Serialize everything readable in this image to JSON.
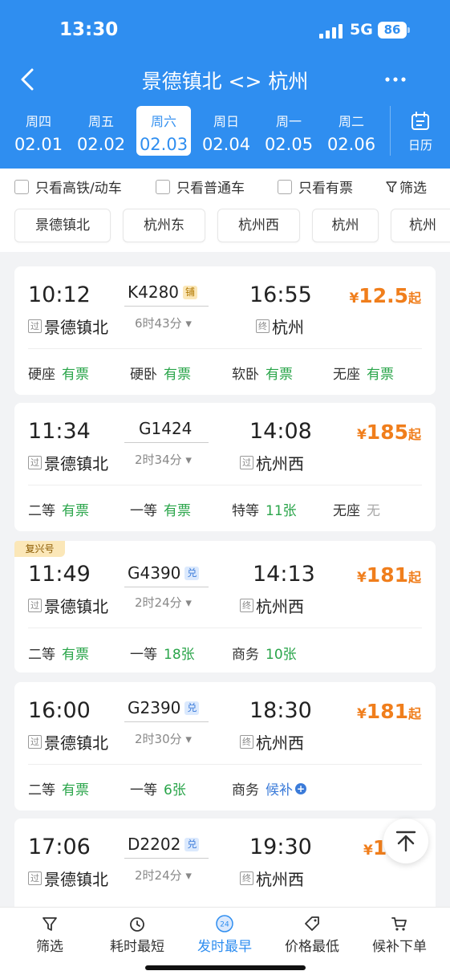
{
  "status": {
    "time": "13:30",
    "network": "5G",
    "battery": "86"
  },
  "nav": {
    "title": "景德镇北 <> 杭州"
  },
  "dates": [
    {
      "weekday": "周四",
      "date": "02.01"
    },
    {
      "weekday": "周五",
      "date": "02.02"
    },
    {
      "weekday": "周六",
      "date": "02.03",
      "active": true
    },
    {
      "weekday": "周日",
      "date": "02.04"
    },
    {
      "weekday": "周一",
      "date": "02.05"
    },
    {
      "weekday": "周二",
      "date": "02.06"
    }
  ],
  "calendar_label": "日历",
  "filters": {
    "high_speed": "只看高铁/动车",
    "normal": "只看普通车",
    "available": "只看有票",
    "filter": "筛选"
  },
  "stations": [
    "景德镇北",
    "杭州东",
    "杭州西",
    "杭州",
    "杭州"
  ],
  "trains": [
    {
      "dep": "10:12",
      "arr": "16:55",
      "train": "K4280",
      "badge": "铺",
      "duration": "6时43分",
      "from_tag": "过",
      "from": "景德镇北",
      "to_tag": "终",
      "to": "杭州",
      "price": "12.5",
      "currency": "¥",
      "price_suffix": "起",
      "seats": [
        {
          "name": "硬座",
          "value": "有票"
        },
        {
          "name": "硬卧",
          "value": "有票"
        },
        {
          "name": "软卧",
          "value": "有票"
        },
        {
          "name": "无座",
          "value": "有票"
        }
      ]
    },
    {
      "dep": "11:34",
      "arr": "14:08",
      "train": "G1424",
      "duration": "2时34分",
      "from_tag": "过",
      "from": "景德镇北",
      "to_tag": "过",
      "to": "杭州西",
      "price": "185",
      "currency": "¥",
      "price_suffix": "起",
      "seats": [
        {
          "name": "二等",
          "value": "有票"
        },
        {
          "name": "一等",
          "value": "有票"
        },
        {
          "name": "特等",
          "value": "11张"
        },
        {
          "name": "无座",
          "value": "无"
        }
      ]
    },
    {
      "label": "复兴号",
      "dep": "11:49",
      "arr": "14:13",
      "train": "G4390",
      "badge": "兑",
      "duration": "2时24分",
      "from_tag": "过",
      "from": "景德镇北",
      "to_tag": "终",
      "to": "杭州西",
      "price": "181",
      "currency": "¥",
      "price_suffix": "起",
      "seats": [
        {
          "name": "二等",
          "value": "有票"
        },
        {
          "name": "一等",
          "value": "18张"
        },
        {
          "name": "商务",
          "value": "10张"
        }
      ]
    },
    {
      "dep": "16:00",
      "arr": "18:30",
      "train": "G2390",
      "badge": "兑",
      "duration": "2时30分",
      "from_tag": "过",
      "from": "景德镇北",
      "to_tag": "终",
      "to": "杭州西",
      "price": "181",
      "currency": "¥",
      "price_suffix": "起",
      "seats": [
        {
          "name": "二等",
          "value": "有票"
        },
        {
          "name": "一等",
          "value": "6张"
        },
        {
          "name": "商务",
          "value": "候补"
        }
      ]
    },
    {
      "dep": "17:06",
      "arr": "19:30",
      "train": "D2202",
      "badge": "兑",
      "duration": "2时24分",
      "from_tag": "过",
      "from": "景德镇北",
      "to_tag": "终",
      "to": "杭州西",
      "price": "16",
      "currency": "¥"
    }
  ],
  "tabs": [
    {
      "label": "筛选",
      "icon": "filter-icon"
    },
    {
      "label": "耗时最短",
      "icon": "clock-icon"
    },
    {
      "label": "发时最早",
      "icon": "earliest-icon",
      "badge": "24",
      "active": true
    },
    {
      "label": "价格最低",
      "icon": "price-tag-icon"
    },
    {
      "label": "候补下单",
      "icon": "cart-icon"
    }
  ],
  "colors": {
    "primary": "#2f8ef0",
    "price": "#f07e1c",
    "available": "#2aa54a",
    "link": "#3b7bd9"
  }
}
